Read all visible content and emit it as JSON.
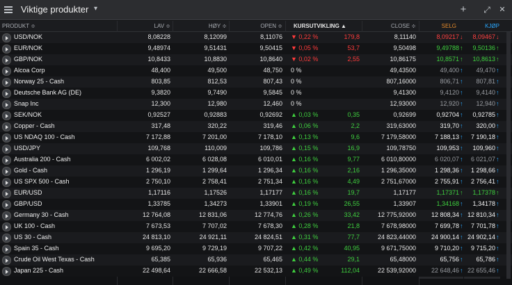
{
  "window": {
    "title": "Viktige produkter",
    "icons": [
      "menu-icon",
      "chevron-down-icon",
      "add-icon",
      "expand-icon",
      "close-icon"
    ],
    "add_label": "+",
    "expand_label": "⤢",
    "close_label": "✕"
  },
  "columns": {
    "product": "PRODUKT ≑",
    "low": "LAV ≑",
    "high": "HØY ≑",
    "open": "OPEN ≑",
    "change": "KURSUTVIKLING ▲",
    "close": "CLOSE ≑",
    "sell": "SELG",
    "buy": "KJØP"
  },
  "rows": [
    {
      "name": "USD/NOK",
      "low": "8,08228",
      "high": "8,12099",
      "open": "8,11076",
      "dir": "dn",
      "pct": "0,22 %",
      "chg": "179,8",
      "close": "8,11140",
      "sell": "8,09217",
      "sellc": "red",
      "buy": "8,09467",
      "buyc": "red",
      "arrow": "dn"
    },
    {
      "name": "EUR/NOK",
      "low": "9,48974",
      "high": "9,51431",
      "open": "9,50415",
      "dir": "dn",
      "pct": "0,05 %",
      "chg": "53,7",
      "close": "9,50498",
      "sell": "9,49788",
      "sellc": "green",
      "buy": "9,50136",
      "buyc": "green",
      "arrow": "up-green"
    },
    {
      "name": "GBP/NOK",
      "low": "10,8433",
      "high": "10,8830",
      "open": "10,8640",
      "dir": "dn",
      "pct": "0,02 %",
      "chg": "2,55",
      "close": "10,86175",
      "sell": "10,8571",
      "sellc": "green",
      "buy": "10,8613",
      "buyc": "green",
      "arrow": "up-green"
    },
    {
      "name": "Alcoa Corp",
      "low": "48,400",
      "high": "49,500",
      "open": "48,750",
      "dir": "neu",
      "pct": "0 %",
      "chg": "",
      "close": "49,43500",
      "sell": "49,400",
      "sellc": "grey",
      "buy": "49,470",
      "buyc": "grey",
      "arrow": "up"
    },
    {
      "name": "Norway 25 - Cash",
      "low": "803,85",
      "high": "812,53",
      "open": "807,43",
      "dir": "neu",
      "pct": "0 %",
      "chg": "",
      "close": "807,16000",
      "sell": "806,71",
      "sellc": "grey",
      "buy": "807,81",
      "buyc": "grey",
      "arrow": "up"
    },
    {
      "name": "Deutsche Bank AG (DE)",
      "low": "9,3820",
      "high": "9,7490",
      "open": "9,5845",
      "dir": "neu",
      "pct": "0 %",
      "chg": "",
      "close": "9,41300",
      "sell": "9,4120",
      "sellc": "grey",
      "buy": "9,4140",
      "buyc": "grey",
      "arrow": "up"
    },
    {
      "name": "Snap Inc",
      "low": "12,300",
      "high": "12,980",
      "open": "12,460",
      "dir": "neu",
      "pct": "0 %",
      "chg": "",
      "close": "12,93000",
      "sell": "12,920",
      "sellc": "grey",
      "buy": "12,940",
      "buyc": "grey",
      "arrow": "up"
    },
    {
      "name": "SEK/NOK",
      "low": "0,92527",
      "high": "0,92883",
      "open": "0,92692",
      "dir": "up",
      "pct": "0,03 %",
      "chg": "0,35",
      "close": "0,92699",
      "sell": "0,92704",
      "sellc": "white",
      "buy": "0,92785",
      "buyc": "white",
      "arrow": "up"
    },
    {
      "name": "Copper - Cash",
      "low": "317,48",
      "high": "320,22",
      "open": "319,46",
      "dir": "up",
      "pct": "0,06 %",
      "chg": "2,2",
      "close": "319,63000",
      "sell": "319,70",
      "sellc": "white",
      "buy": "320,00",
      "buyc": "white",
      "arrow": "up"
    },
    {
      "name": "US NDAQ 100 - Cash",
      "low": "7 172,88",
      "high": "7 201,00",
      "open": "7 178,10",
      "dir": "up",
      "pct": "0,13 %",
      "chg": "9,6",
      "close": "7 179,58000",
      "sell": "7 188,13",
      "sellc": "white",
      "buy": "7 190,18",
      "buyc": "white",
      "arrow": "up"
    },
    {
      "name": "USD/JPY",
      "low": "109,768",
      "high": "110,009",
      "open": "109,786",
      "dir": "up",
      "pct": "0,15 %",
      "chg": "16,9",
      "close": "109,78750",
      "sell": "109,953",
      "sellc": "white",
      "buy": "109,960",
      "buyc": "white",
      "arrow": "up"
    },
    {
      "name": "Australia 200 - Cash",
      "low": "6 002,02",
      "high": "6 028,08",
      "open": "6 010,01",
      "dir": "up",
      "pct": "0,16 %",
      "chg": "9,77",
      "close": "6 010,80000",
      "sell": "6 020,07",
      "sellc": "grey",
      "buy": "6 021,07",
      "buyc": "grey",
      "arrow": "up"
    },
    {
      "name": "Gold - Cash",
      "low": "1 296,19",
      "high": "1 299,64",
      "open": "1 296,34",
      "dir": "up",
      "pct": "0,16 %",
      "chg": "2,16",
      "close": "1 296,35000",
      "sell": "1 298,36",
      "sellc": "white",
      "buy": "1 298,66",
      "buyc": "white",
      "arrow": "up"
    },
    {
      "name": "US SPX 500 - Cash",
      "low": "2 750,10",
      "high": "2 758,41",
      "open": "2 751,34",
      "dir": "up",
      "pct": "0,16 %",
      "chg": "4,49",
      "close": "2 751,67000",
      "sell": "2 755,91",
      "sellc": "white",
      "buy": "2 756,41",
      "buyc": "white",
      "arrow": "up"
    },
    {
      "name": "EUR/USD",
      "low": "1,17116",
      "high": "1,17526",
      "open": "1,17177",
      "dir": "up",
      "pct": "0,16 %",
      "chg": "19,7",
      "close": "1,17177",
      "sell": "1,17371",
      "sellc": "green",
      "buy": "1,17378",
      "buyc": "green",
      "arrow": "up-green"
    },
    {
      "name": "GBP/USD",
      "low": "1,33785",
      "high": "1,34273",
      "open": "1,33901",
      "dir": "up",
      "pct": "0,19 %",
      "chg": "26,55",
      "close": "1,33907",
      "sell": "1,34168",
      "sellc": "green",
      "buy": "1,34178",
      "buyc": "white",
      "arrow": "up"
    },
    {
      "name": "Germany 30 - Cash",
      "low": "12 764,08",
      "high": "12 831,06",
      "open": "12 774,76",
      "dir": "up",
      "pct": "0,26 %",
      "chg": "33,42",
      "close": "12 775,92000",
      "sell": "12 808,34",
      "sellc": "white",
      "buy": "12 810,34",
      "buyc": "white",
      "arrow": "up"
    },
    {
      "name": "UK 100 - Cash",
      "low": "7 673,53",
      "high": "7 707,02",
      "open": "7 678,30",
      "dir": "up",
      "pct": "0,28 %",
      "chg": "21,8",
      "close": "7 678,98000",
      "sell": "7 699,78",
      "sellc": "white",
      "buy": "7 701,78",
      "buyc": "white",
      "arrow": "up"
    },
    {
      "name": "US 30 - Cash",
      "low": "24 813,10",
      "high": "24 921,11",
      "open": "24 824,51",
      "dir": "up",
      "pct": "0,31 %",
      "chg": "77,7",
      "close": "24 823,44000",
      "sell": "24 900,14",
      "sellc": "white",
      "buy": "24 902,14",
      "buyc": "white",
      "arrow": "up"
    },
    {
      "name": "Spain 35 - Cash",
      "low": "9 695,20",
      "high": "9 729,19",
      "open": "9 707,22",
      "dir": "up",
      "pct": "0,42 %",
      "chg": "40,95",
      "close": "9 671,75000",
      "sell": "9 710,20",
      "sellc": "white",
      "buy": "9 715,20",
      "buyc": "white",
      "arrow": "up"
    },
    {
      "name": "Crude Oil West Texas - Cash",
      "low": "65,385",
      "high": "65,936",
      "open": "65,465",
      "dir": "up",
      "pct": "0,44 %",
      "chg": "29,1",
      "close": "65,48000",
      "sell": "65,756",
      "sellc": "white",
      "buy": "65,786",
      "buyc": "white",
      "arrow": "up"
    },
    {
      "name": "Japan 225 - Cash",
      "low": "22 498,64",
      "high": "22 666,58",
      "open": "22 532,13",
      "dir": "up",
      "pct": "0,49 %",
      "chg": "112,04",
      "close": "22 539,92000",
      "sell": "22 648,46",
      "sellc": "grey",
      "buy": "22 655,46",
      "buyc": "grey",
      "arrow": "up"
    }
  ]
}
